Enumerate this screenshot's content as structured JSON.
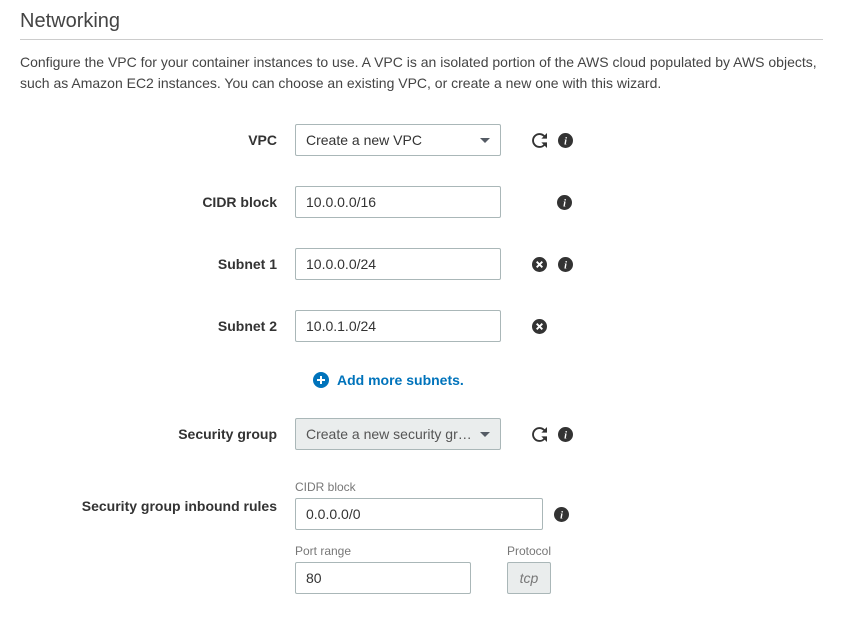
{
  "section": {
    "title": "Networking",
    "description": "Configure the VPC for your container instances to use. A VPC is an isolated portion of the AWS cloud populated by AWS objects, such as Amazon EC2 instances. You can choose an existing VPC, or create a new one with this wizard."
  },
  "labels": {
    "vpc": "VPC",
    "cidr_block": "CIDR block",
    "subnet1": "Subnet 1",
    "subnet2": "Subnet 2",
    "security_group": "Security group",
    "inbound_rules": "Security group inbound rules",
    "sub_cidr": "CIDR block",
    "sub_port": "Port range",
    "sub_protocol": "Protocol"
  },
  "values": {
    "vpc_selected": "Create a new VPC",
    "cidr_block": "10.0.0.0/16",
    "subnet1": "10.0.0.0/24",
    "subnet2": "10.0.1.0/24",
    "security_group_selected": "Create a new security gr…",
    "inbound_cidr": "0.0.0.0/0",
    "inbound_port": "80",
    "inbound_protocol": "tcp"
  },
  "actions": {
    "add_subnets": "Add more subnets."
  }
}
